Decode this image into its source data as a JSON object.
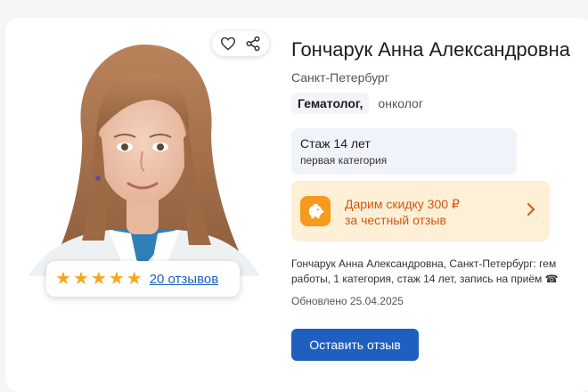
{
  "doctor": {
    "name": "Гончарук Анна Александровна",
    "city": "Санкт-Петербург",
    "specialty_primary": "Гематолог,",
    "specialty_secondary": "онколог"
  },
  "experience": {
    "title": "Стаж 14 лет",
    "category": "первая категория"
  },
  "promo": {
    "line1": "Дарим скидку 300 ₽",
    "line2": "за честный отзыв"
  },
  "rating": {
    "stars": 5,
    "reviews_label": "20 отзывов"
  },
  "description": {
    "line1": "Гончарук Анна Александровна, Санкт-Петербург: гем",
    "line2": "работы, 1 категория, стаж 14 лет, запись на приём ☎"
  },
  "updated": "Обновлено 25.04.2025",
  "button": {
    "leave_review": "Оставить отзыв"
  },
  "colors": {
    "accent": "#1f5fbf",
    "star": "#f5a623",
    "promo_bg": "#fdf0d6",
    "promo_text": "#d4560f"
  },
  "icons": [
    "heart-icon",
    "share-icon",
    "star-icon",
    "piggy-bank-icon",
    "chevron-right-icon"
  ]
}
